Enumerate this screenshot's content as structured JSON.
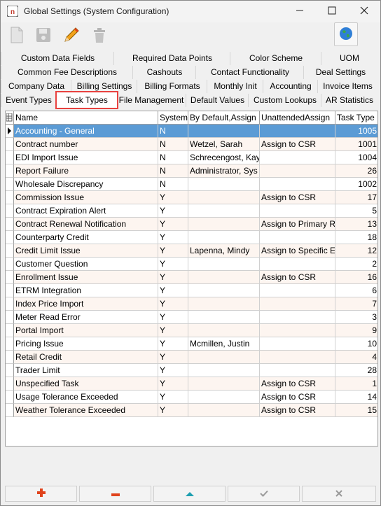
{
  "window": {
    "title": "Global Settings (System Configuration)",
    "minimize_icon": "minimize-icon",
    "maximize_icon": "maximize-icon",
    "close_icon": "close-icon"
  },
  "toolbar": {
    "icons": [
      "new-document-icon",
      "save-icon",
      "edit-pencil-icon",
      "delete-trash-icon"
    ],
    "globe_icon": "globe-icon"
  },
  "tabs": {
    "row1": [
      "Custom Data Fields",
      "Required Data Points",
      "Color Scheme",
      "UOM"
    ],
    "row2": [
      "Common Fee Descriptions",
      "Cashouts",
      "Contact Functionality",
      "Deal Settings"
    ],
    "row3": [
      "Company Data",
      "Billing Settings",
      "Billing Formats",
      "Monthly Init",
      "Accounting",
      "Invoice Items"
    ],
    "row4": [
      "Event Types",
      "Task Types",
      "File Management",
      "Default Values",
      "Custom Lookups",
      "AR Statistics"
    ],
    "active": "Task Types"
  },
  "grid": {
    "columns": [
      "Name",
      "System'",
      "By Default,Assign",
      "UnattendedAssign",
      "Task Type I"
    ],
    "rows": [
      [
        "Accounting - General",
        "N",
        "",
        "",
        "1005"
      ],
      [
        "Contract number",
        "N",
        "Wetzel, Sarah",
        "Assign to CSR",
        "1001"
      ],
      [
        "EDI Import Issue",
        "N",
        "Schrecengost, Kay",
        "",
        "1004"
      ],
      [
        "Report Failure",
        "N",
        "Administrator, Sys",
        "",
        "26"
      ],
      [
        "Wholesale Discrepancy",
        "N",
        "",
        "",
        "1002"
      ],
      [
        "Commission Issue",
        "Y",
        "",
        "Assign to CSR",
        "17"
      ],
      [
        "Contract Expiration Alert",
        "Y",
        "",
        "",
        "5"
      ],
      [
        "Contract Renewal Notification",
        "Y",
        "",
        "Assign to Primary R",
        "13"
      ],
      [
        "Counterparty Credit",
        "Y",
        "",
        "",
        "18"
      ],
      [
        "Credit Limit Issue",
        "Y",
        "Lapenna, Mindy",
        "Assign to Specific E",
        "12"
      ],
      [
        "Customer Question",
        "Y",
        "",
        "",
        "2"
      ],
      [
        "Enrollment Issue",
        "Y",
        "",
        "Assign to CSR",
        "16"
      ],
      [
        "ETRM Integration",
        "Y",
        "",
        "",
        "6"
      ],
      [
        "Index Price Import",
        "Y",
        "",
        "",
        "7"
      ],
      [
        "Meter Read Error",
        "Y",
        "",
        "",
        "3"
      ],
      [
        "Portal Import",
        "Y",
        "",
        "",
        "9"
      ],
      [
        "Pricing Issue",
        "Y",
        "Mcmillen, Justin",
        "",
        "10"
      ],
      [
        "Retail Credit",
        "Y",
        "",
        "",
        "4"
      ],
      [
        "Trader Limit",
        "Y",
        "",
        "",
        "28"
      ],
      [
        "Unspecified Task",
        "Y",
        "",
        "Assign to CSR",
        "1"
      ],
      [
        "Usage Tolerance Exceeded",
        "Y",
        "",
        "Assign to CSR",
        "14"
      ],
      [
        "Weather Tolerance Exceeded",
        "Y",
        "",
        "Assign to CSR",
        "15"
      ]
    ]
  },
  "bottom_bar": {
    "buttons": [
      "add-plus-icon",
      "remove-minus-icon",
      "move-up-icon",
      "confirm-check-icon",
      "cancel-x-icon"
    ],
    "colors": {
      "add": "#e0431c",
      "remove": "#e0431c",
      "up": "#1e9fb0",
      "disabled": "#9a9a9a"
    }
  },
  "colors": {
    "selection": "#5b9bd5",
    "active_tab_border": "#e8423f",
    "alt_row": "#fdf5f0"
  }
}
